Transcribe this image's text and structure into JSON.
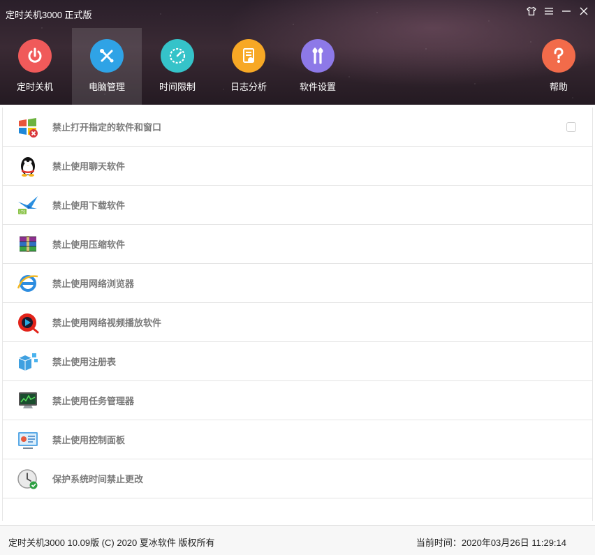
{
  "window": {
    "title": "定时关机3000 正式版"
  },
  "nav": {
    "items": [
      {
        "label": "定时关机",
        "icon": "power-icon",
        "color": "#f05a5a"
      },
      {
        "label": "电脑管理",
        "icon": "tools-icon",
        "color": "#2fa3e6"
      },
      {
        "label": "时间限制",
        "icon": "speedometer-icon",
        "color": "#35c3c9"
      },
      {
        "label": "日志分析",
        "icon": "document-icon",
        "color": "#f7a825"
      },
      {
        "label": "软件设置",
        "icon": "wrench-icon",
        "color": "#8d79e8"
      },
      {
        "label": "帮助",
        "icon": "question-icon",
        "color": "#f26b4a"
      }
    ],
    "active_index": 1
  },
  "list": {
    "rows": [
      {
        "label": "禁止打开指定的软件和窗口",
        "icon": "windows-blocked-icon"
      },
      {
        "label": "禁止使用聊天软件",
        "icon": "penguin-icon"
      },
      {
        "label": "禁止使用下载软件",
        "icon": "download-bird-icon"
      },
      {
        "label": "禁止使用压缩软件",
        "icon": "archive-books-icon"
      },
      {
        "label": "禁止使用网络浏览器",
        "icon": "ie-browser-icon"
      },
      {
        "label": "禁止使用网络视频播放软件",
        "icon": "video-player-icon"
      },
      {
        "label": "禁止使用注册表",
        "icon": "registry-cubes-icon"
      },
      {
        "label": "禁止使用任务管理器",
        "icon": "monitor-icon"
      },
      {
        "label": "禁止使用控制面板",
        "icon": "control-panel-icon"
      },
      {
        "label": "保护系统时间禁止更改",
        "icon": "clock-icon"
      }
    ]
  },
  "status": {
    "copyright": "定时关机3000 10.09版 (C) 2020  夏冰软件 版权所有",
    "current_time": "当前时间：2020年03月26日 11:29:14"
  }
}
